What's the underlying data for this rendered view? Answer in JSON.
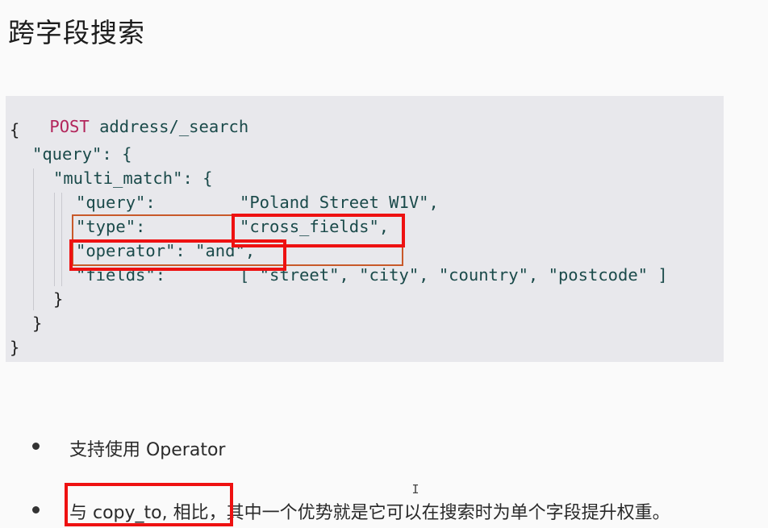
{
  "title": "跨字段搜索",
  "code": {
    "method": "POST",
    "path": " address/_search",
    "open_brace": "{",
    "query_line": "\"query\": {",
    "multi_match_line": "\"multi_match\": {",
    "query_key": "\"query\":",
    "query_value": "\"Poland Street W1V\",",
    "type_key": "\"type\":",
    "type_value": "\"cross_fields\",",
    "operator_line": "\"operator\": \"and\",",
    "fields_key": "\"fields\":",
    "fields_value": "[ \"street\", \"city\", \"country\", \"postcode\" ]",
    "close_inner": "}",
    "close_query": "}",
    "close_root": "}"
  },
  "bullets": [
    {
      "text": "支持使用 Operator"
    },
    {
      "text": "与 copy_to, 相比，其中一个优势就是它可以在搜索时为单个字段提升权重。"
    }
  ],
  "colors": {
    "method": "#b2245a",
    "code_text": "#1a4a4a",
    "code_bg": "#e8e8ec",
    "highlight_red": "#ee1111",
    "highlight_orange": "#c8592a"
  }
}
